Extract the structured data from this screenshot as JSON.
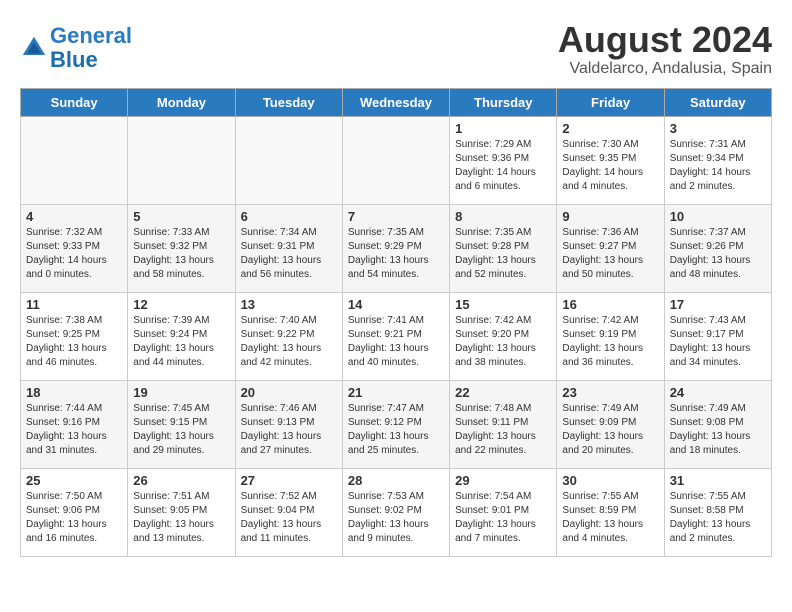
{
  "logo": {
    "line1": "General",
    "line2": "Blue"
  },
  "title": "August 2024",
  "location": "Valdelarco, Andalusia, Spain",
  "weekdays": [
    "Sunday",
    "Monday",
    "Tuesday",
    "Wednesday",
    "Thursday",
    "Friday",
    "Saturday"
  ],
  "weeks": [
    [
      {
        "day": "",
        "info": ""
      },
      {
        "day": "",
        "info": ""
      },
      {
        "day": "",
        "info": ""
      },
      {
        "day": "",
        "info": ""
      },
      {
        "day": "1",
        "info": "Sunrise: 7:29 AM\nSunset: 9:36 PM\nDaylight: 14 hours\nand 6 minutes."
      },
      {
        "day": "2",
        "info": "Sunrise: 7:30 AM\nSunset: 9:35 PM\nDaylight: 14 hours\nand 4 minutes."
      },
      {
        "day": "3",
        "info": "Sunrise: 7:31 AM\nSunset: 9:34 PM\nDaylight: 14 hours\nand 2 minutes."
      }
    ],
    [
      {
        "day": "4",
        "info": "Sunrise: 7:32 AM\nSunset: 9:33 PM\nDaylight: 14 hours\nand 0 minutes."
      },
      {
        "day": "5",
        "info": "Sunrise: 7:33 AM\nSunset: 9:32 PM\nDaylight: 13 hours\nand 58 minutes."
      },
      {
        "day": "6",
        "info": "Sunrise: 7:34 AM\nSunset: 9:31 PM\nDaylight: 13 hours\nand 56 minutes."
      },
      {
        "day": "7",
        "info": "Sunrise: 7:35 AM\nSunset: 9:29 PM\nDaylight: 13 hours\nand 54 minutes."
      },
      {
        "day": "8",
        "info": "Sunrise: 7:35 AM\nSunset: 9:28 PM\nDaylight: 13 hours\nand 52 minutes."
      },
      {
        "day": "9",
        "info": "Sunrise: 7:36 AM\nSunset: 9:27 PM\nDaylight: 13 hours\nand 50 minutes."
      },
      {
        "day": "10",
        "info": "Sunrise: 7:37 AM\nSunset: 9:26 PM\nDaylight: 13 hours\nand 48 minutes."
      }
    ],
    [
      {
        "day": "11",
        "info": "Sunrise: 7:38 AM\nSunset: 9:25 PM\nDaylight: 13 hours\nand 46 minutes."
      },
      {
        "day": "12",
        "info": "Sunrise: 7:39 AM\nSunset: 9:24 PM\nDaylight: 13 hours\nand 44 minutes."
      },
      {
        "day": "13",
        "info": "Sunrise: 7:40 AM\nSunset: 9:22 PM\nDaylight: 13 hours\nand 42 minutes."
      },
      {
        "day": "14",
        "info": "Sunrise: 7:41 AM\nSunset: 9:21 PM\nDaylight: 13 hours\nand 40 minutes."
      },
      {
        "day": "15",
        "info": "Sunrise: 7:42 AM\nSunset: 9:20 PM\nDaylight: 13 hours\nand 38 minutes."
      },
      {
        "day": "16",
        "info": "Sunrise: 7:42 AM\nSunset: 9:19 PM\nDaylight: 13 hours\nand 36 minutes."
      },
      {
        "day": "17",
        "info": "Sunrise: 7:43 AM\nSunset: 9:17 PM\nDaylight: 13 hours\nand 34 minutes."
      }
    ],
    [
      {
        "day": "18",
        "info": "Sunrise: 7:44 AM\nSunset: 9:16 PM\nDaylight: 13 hours\nand 31 minutes."
      },
      {
        "day": "19",
        "info": "Sunrise: 7:45 AM\nSunset: 9:15 PM\nDaylight: 13 hours\nand 29 minutes."
      },
      {
        "day": "20",
        "info": "Sunrise: 7:46 AM\nSunset: 9:13 PM\nDaylight: 13 hours\nand 27 minutes."
      },
      {
        "day": "21",
        "info": "Sunrise: 7:47 AM\nSunset: 9:12 PM\nDaylight: 13 hours\nand 25 minutes."
      },
      {
        "day": "22",
        "info": "Sunrise: 7:48 AM\nSunset: 9:11 PM\nDaylight: 13 hours\nand 22 minutes."
      },
      {
        "day": "23",
        "info": "Sunrise: 7:49 AM\nSunset: 9:09 PM\nDaylight: 13 hours\nand 20 minutes."
      },
      {
        "day": "24",
        "info": "Sunrise: 7:49 AM\nSunset: 9:08 PM\nDaylight: 13 hours\nand 18 minutes."
      }
    ],
    [
      {
        "day": "25",
        "info": "Sunrise: 7:50 AM\nSunset: 9:06 PM\nDaylight: 13 hours\nand 16 minutes."
      },
      {
        "day": "26",
        "info": "Sunrise: 7:51 AM\nSunset: 9:05 PM\nDaylight: 13 hours\nand 13 minutes."
      },
      {
        "day": "27",
        "info": "Sunrise: 7:52 AM\nSunset: 9:04 PM\nDaylight: 13 hours\nand 11 minutes."
      },
      {
        "day": "28",
        "info": "Sunrise: 7:53 AM\nSunset: 9:02 PM\nDaylight: 13 hours\nand 9 minutes."
      },
      {
        "day": "29",
        "info": "Sunrise: 7:54 AM\nSunset: 9:01 PM\nDaylight: 13 hours\nand 7 minutes."
      },
      {
        "day": "30",
        "info": "Sunrise: 7:55 AM\nSunset: 8:59 PM\nDaylight: 13 hours\nand 4 minutes."
      },
      {
        "day": "31",
        "info": "Sunrise: 7:55 AM\nSunset: 8:58 PM\nDaylight: 13 hours\nand 2 minutes."
      }
    ]
  ]
}
